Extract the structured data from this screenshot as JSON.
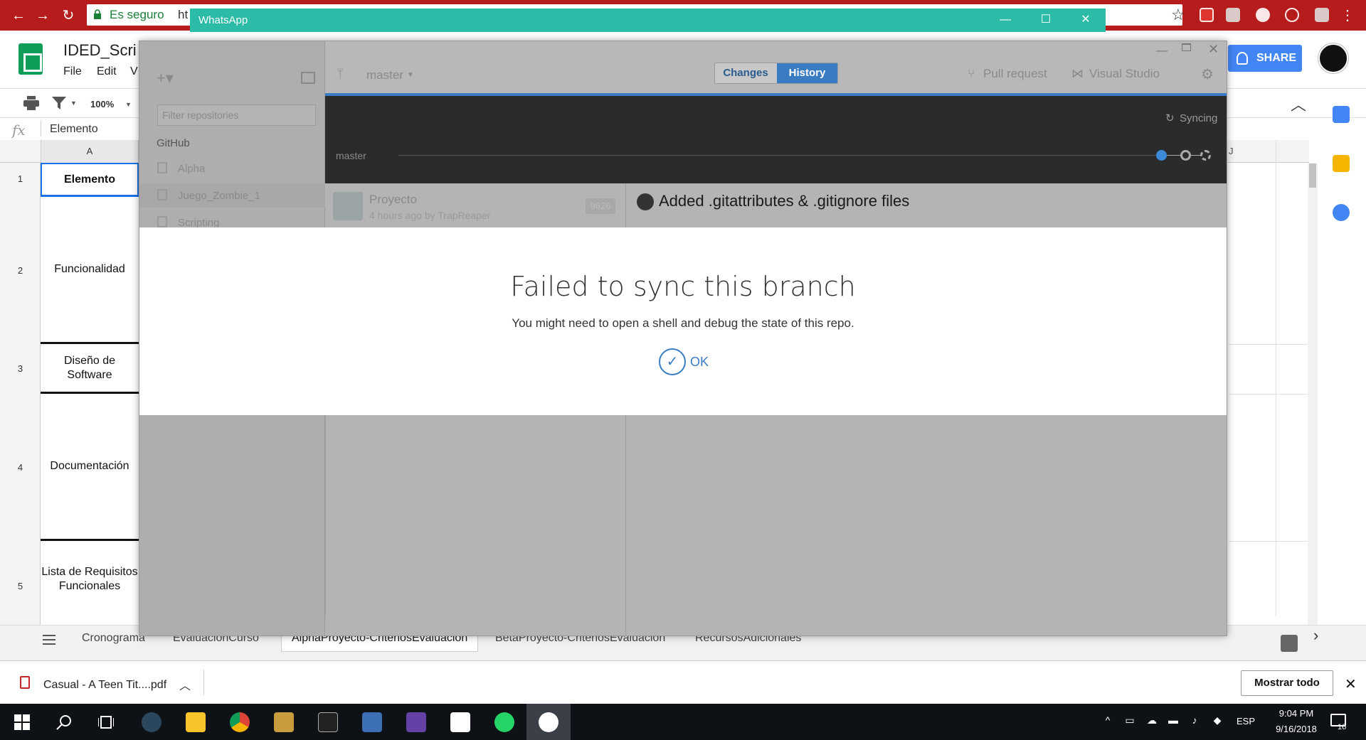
{
  "browser": {
    "secure_label": "Es seguro",
    "url_fragment": "ht"
  },
  "sheets": {
    "doc_title": "IDED_Scri",
    "menu": [
      "File",
      "Edit",
      "V"
    ],
    "share_label": "SHARE",
    "zoom": "100%",
    "formula_value": "Elemento",
    "col_a_header": "A",
    "col_j_header": "J",
    "rows": [
      {
        "num": "1",
        "value": "Elemento"
      },
      {
        "num": "2",
        "value": "Funcionalidad"
      },
      {
        "num": "3",
        "value": "Diseño de Software"
      },
      {
        "num": "4",
        "value": "Documentación"
      },
      {
        "num": "5",
        "value": "Lista de Requisitos Funcionales"
      }
    ],
    "tabs": [
      "Cronograma",
      "EvaluacionCurso",
      "AlphaProyecto-CriteriosEvaluacion",
      "BetaProyecto-CriteriosEvaluacion",
      "RecursosAdicionales"
    ],
    "active_tab_index": 2
  },
  "whatsapp": {
    "title": "WhatsApp"
  },
  "github_desktop": {
    "branch": "master",
    "tabs": {
      "changes": "Changes",
      "history": "History"
    },
    "pull_request": "Pull request",
    "visual_studio": "Visual Studio",
    "filter_placeholder": "Filter repositories",
    "group_label": "GitHub",
    "repos": [
      "Alpha",
      "Juego_Zombie_1",
      "Scripting"
    ],
    "timeline_branch": "master",
    "sync_status": "Syncing",
    "commit": {
      "title": "Proyecto",
      "meta": "4 hours ago by TrapReaper",
      "sha": "9626"
    },
    "selected_commit_title": "Added .gitattributes & .gitignore files",
    "modal": {
      "title": "Failed to sync this branch",
      "body": "You might need to open a shell and debug the state of this repo.",
      "ok_label": "OK"
    }
  },
  "downloads": {
    "file_name": "Casual - A Teen Tit....pdf",
    "show_all": "Mostrar todo"
  },
  "taskbar": {
    "language": "ESP",
    "time": "9:04 PM",
    "date": "9/16/2018",
    "notification_count": "16"
  },
  "colors": {
    "chrome_bar": "#b71c1c",
    "sheets_green": "#0f9d58",
    "share_blue": "#4285f4",
    "whatsapp_teal": "#2bbba6",
    "github_blue": "#3a7cc4",
    "taskbar": "#0e1116"
  }
}
